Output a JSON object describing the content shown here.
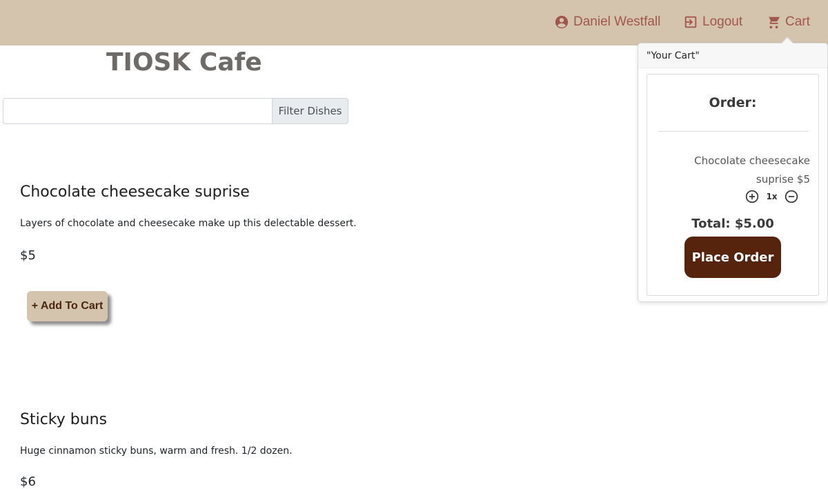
{
  "nav": {
    "user_name": "Daniel Westfall",
    "logout_label": "Logout",
    "cart_label": "Cart"
  },
  "page": {
    "title": "TIOSK Cafe"
  },
  "filter": {
    "input_value": "",
    "button_label": "Filter Dishes"
  },
  "dishes": [
    {
      "name": "Chocolate cheesecake suprise",
      "description": "Layers of chocolate and cheesecake make up this delectable dessert.",
      "price": "$5",
      "add_label": "+ Add To Cart"
    },
    {
      "name": "Sticky buns",
      "description": "Huge cinnamon sticky buns, warm and fresh. 1/2 dozen.",
      "price": "$6"
    }
  ],
  "cart": {
    "header": "\"Your Cart\"",
    "order_title": "Order:",
    "items": [
      {
        "name_line1": "Chocolate cheesecake",
        "name_line2": "suprise  $5",
        "quantity": "1x"
      }
    ],
    "total": "Total: $5.00",
    "place_order_label": "Place Order"
  },
  "colors": {
    "topbar": "#d5c4ad",
    "nav_text": "#a0564c",
    "place_order": "#56240d"
  }
}
